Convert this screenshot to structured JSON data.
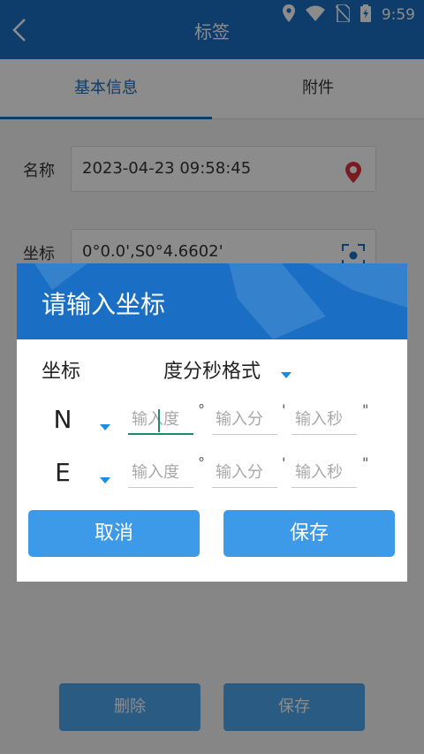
{
  "status_bar": {
    "time": "9:59"
  },
  "header": {
    "title": "标签"
  },
  "tabs": [
    {
      "label": "基本信息"
    },
    {
      "label": "附件"
    }
  ],
  "form": {
    "name_label": "名称",
    "name_value": "2023-04-23 09:58:45",
    "coord_label": "坐标",
    "coord_value": "0°0.0',S0°4.6602'"
  },
  "bottom_buttons": {
    "delete": "删除",
    "save": "保存"
  },
  "dialog": {
    "title": "请输入坐标",
    "format_label": "坐标",
    "format_value": "度分秒格式",
    "rows": [
      {
        "hemisphere": "N",
        "deg_placeholder": "输入度",
        "min_placeholder": "输入分",
        "sec_placeholder": "输入秒"
      },
      {
        "hemisphere": "E",
        "deg_placeholder": "输入度",
        "min_placeholder": "输入分",
        "sec_placeholder": "输入秒"
      }
    ],
    "units": {
      "deg": "°",
      "min": "'",
      "sec": "\""
    },
    "cancel_label": "取消",
    "save_label": "保存"
  },
  "colors": {
    "primary": "#1a6fc4",
    "button": "#3d9ae8",
    "focus": "#1e8a6f",
    "location_pin": "#d9363e"
  }
}
